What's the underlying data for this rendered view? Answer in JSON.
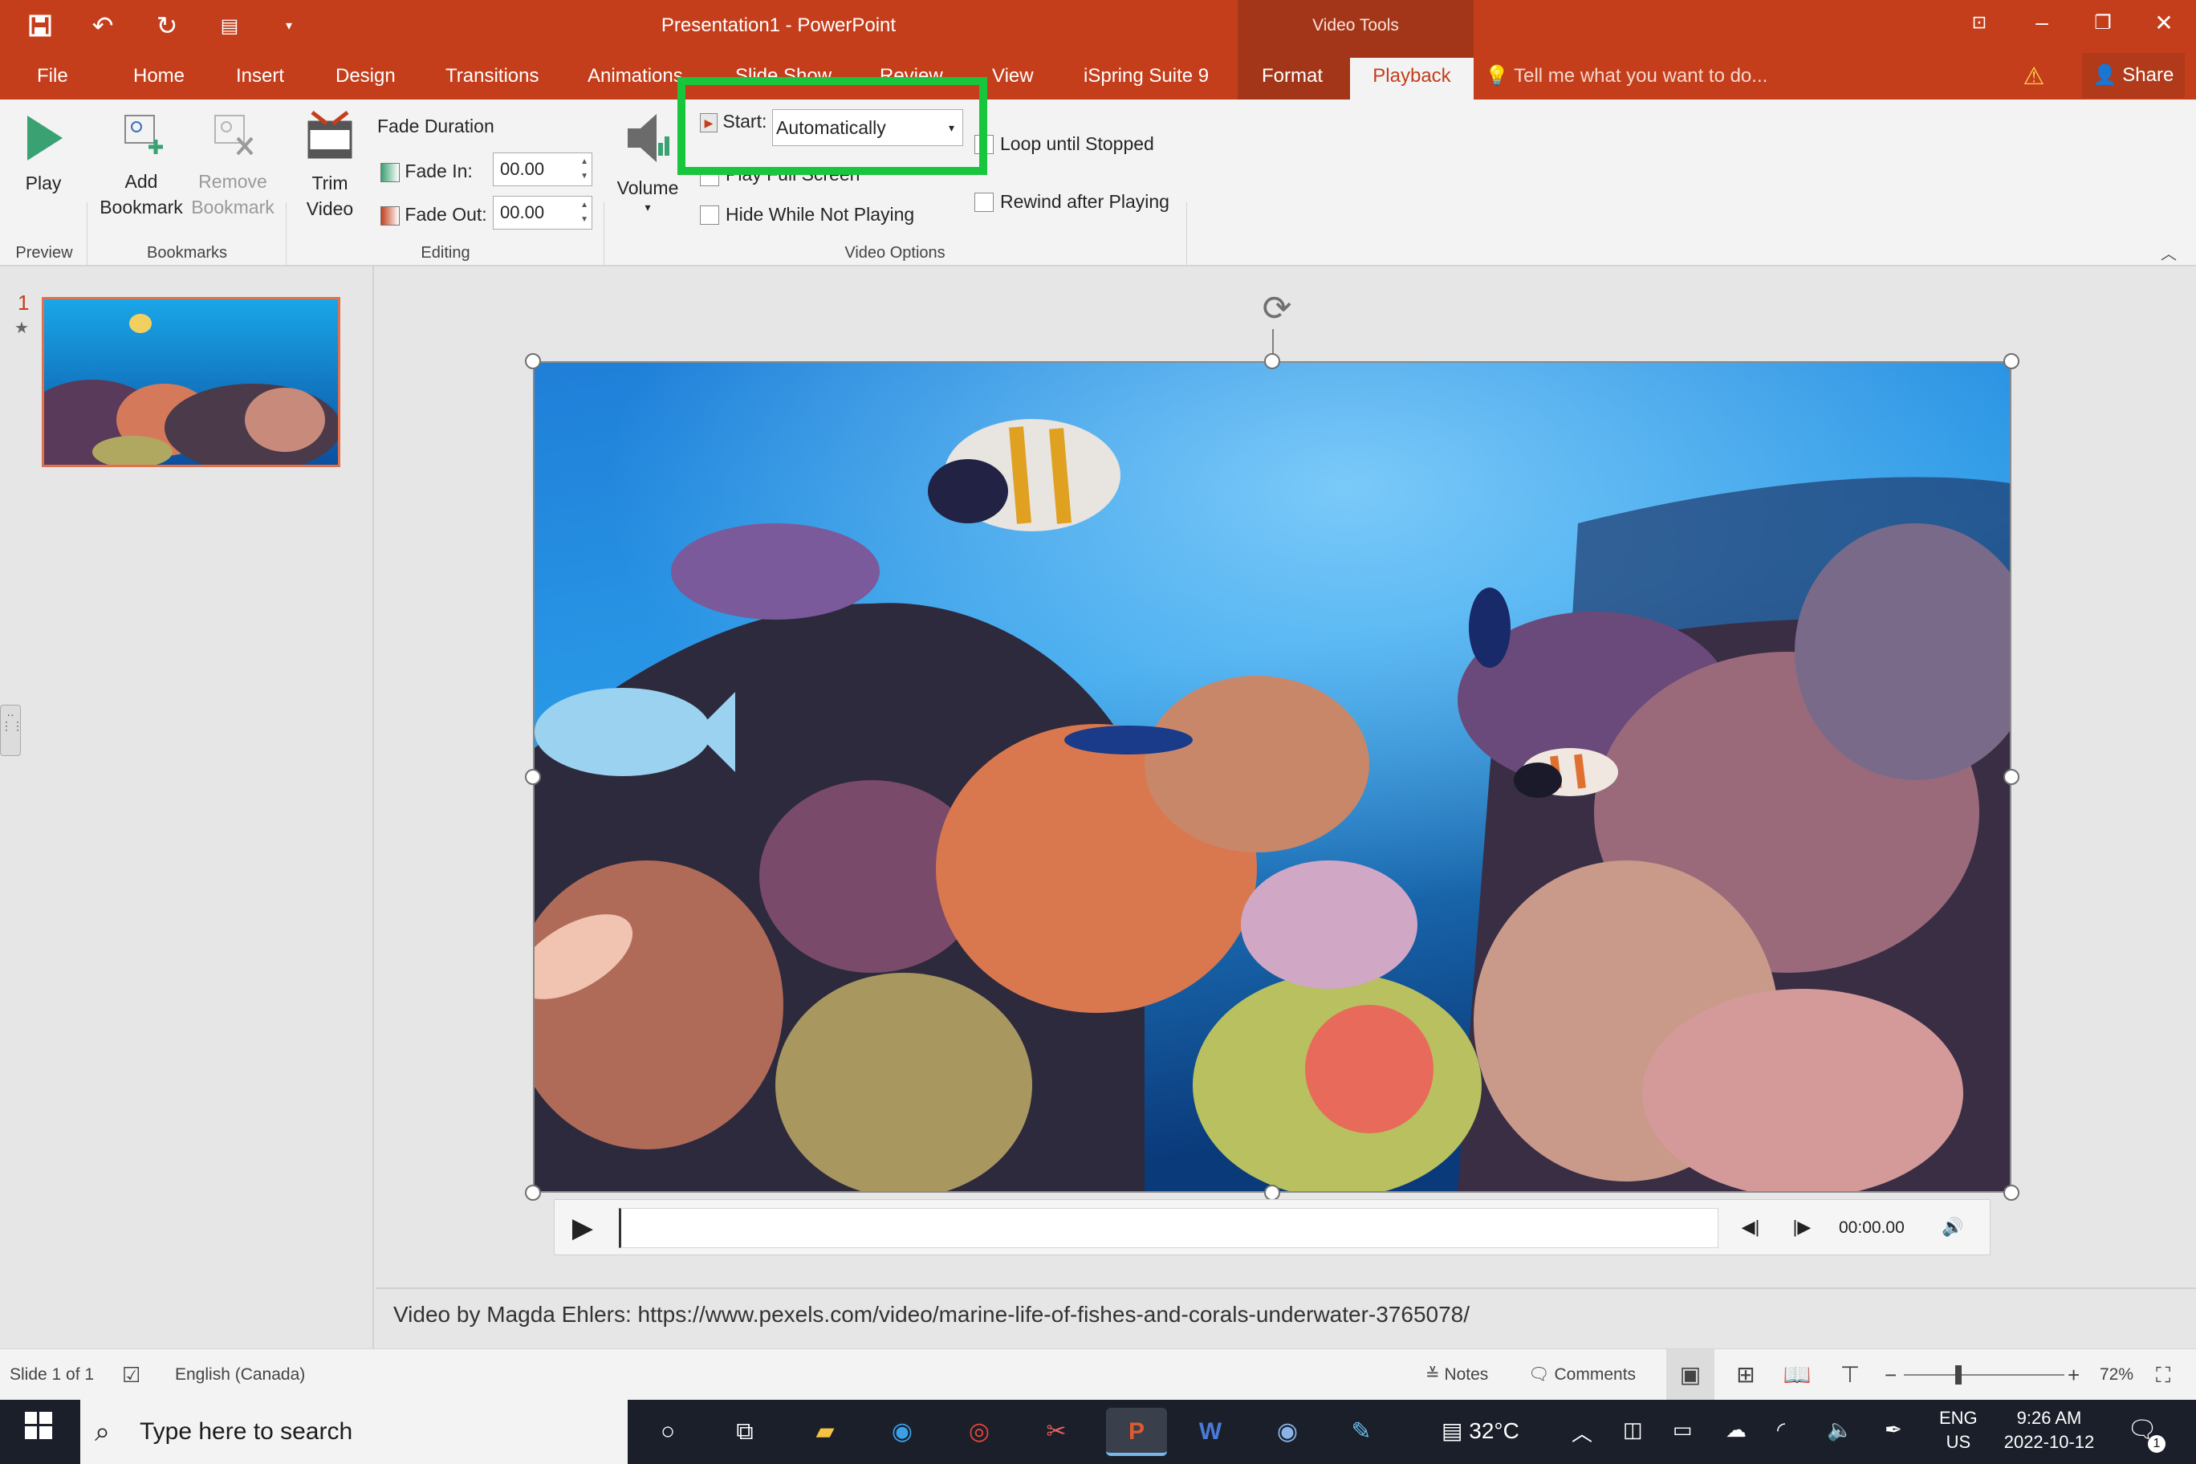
{
  "app": {
    "title": "Presentation1 - PowerPoint",
    "context_tab_group": "Video Tools"
  },
  "tabs": [
    "File",
    "Home",
    "Insert",
    "Design",
    "Transitions",
    "Animations",
    "Slide Show",
    "Review",
    "View",
    "iSpring Suite 9",
    "Format",
    "Playback"
  ],
  "active_tab": "Playback",
  "tell_me": "Tell me what you want to do...",
  "share": "Share",
  "ribbon": {
    "preview": {
      "play": "Play",
      "group": "Preview"
    },
    "bookmarks": {
      "add_line1": "Add",
      "add_line2": "Bookmark",
      "remove_line1": "Remove",
      "remove_line2": "Bookmark",
      "group": "Bookmarks"
    },
    "editing": {
      "trim_line1": "Trim",
      "trim_line2": "Video",
      "fade_duration": "Fade Duration",
      "fade_in_label": "Fade In:",
      "fade_in_value": "00.00",
      "fade_out_label": "Fade Out:",
      "fade_out_value": "00.00",
      "group": "Editing"
    },
    "video_options": {
      "volume": "Volume",
      "start_label": "Start:",
      "start_value": "Automatically",
      "play_full_screen": "Play Full Screen",
      "hide_while_not_playing": "Hide While Not Playing",
      "loop_until_stopped": "Loop until Stopped",
      "rewind_after_playing": "Rewind after Playing",
      "group": "Video Options"
    }
  },
  "slides": {
    "current_number": "1"
  },
  "player": {
    "time": "00:00.00"
  },
  "notes": "Video by Magda Ehlers: https://www.pexels.com/video/marine-life-of-fishes-and-corals-underwater-3765078/",
  "status": {
    "slide": "Slide 1 of 1",
    "language": "English (Canada)",
    "notes": "Notes",
    "comments": "Comments",
    "zoom": "72%"
  },
  "taskbar": {
    "search_placeholder": "Type here to search",
    "weather": "32°C",
    "lang_line1": "ENG",
    "lang_line2": "US",
    "time": "9:26 AM",
    "date": "2022-10-12",
    "notification_count": "1"
  },
  "colors": {
    "accent": "#c43e1c",
    "highlight": "#18c53c"
  }
}
